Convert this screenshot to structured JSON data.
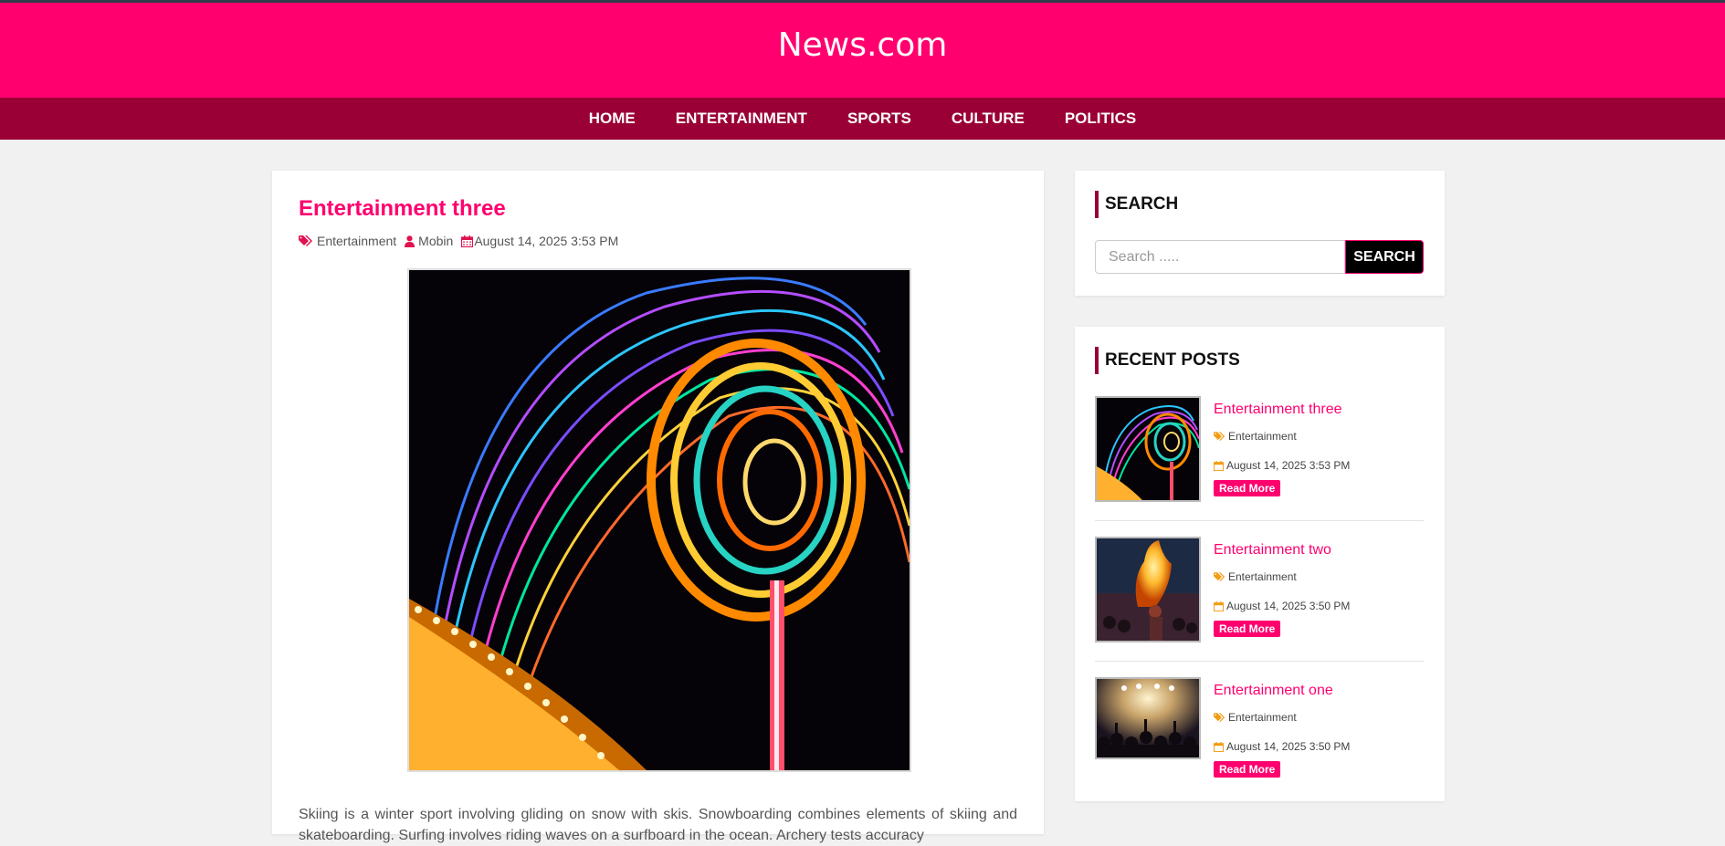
{
  "header": {
    "site_title": "News.com"
  },
  "nav": {
    "items": [
      "HOME",
      "ENTERTAINMENT",
      "SPORTS",
      "CULTURE",
      "POLITICS"
    ]
  },
  "post": {
    "title": "Entertainment three",
    "category": "Entertainment",
    "author": "Mobin",
    "date": "August 14, 2025 3:53 PM",
    "body": "Skiing is a winter sport involving gliding on snow with skis. Snowboarding combines elements of skiing and skateboarding. Surfing involves riding waves on a surfboard in the ocean. Archery tests accuracy"
  },
  "sidebar": {
    "search": {
      "title": "SEARCH",
      "placeholder": "Search .....",
      "button_label": "SEARCH"
    },
    "recent": {
      "title": "RECENT POSTS",
      "items": [
        {
          "title": "Entertainment three",
          "category": "Entertainment",
          "date": "August 14, 2025 3:53 PM",
          "button": "Read More"
        },
        {
          "title": "Entertainment two",
          "category": "Entertainment",
          "date": "August 14, 2025 3:50 PM",
          "button": "Read More"
        },
        {
          "title": "Entertainment one",
          "category": "Entertainment",
          "date": "August 14, 2025 3:50 PM",
          "button": "Read More"
        }
      ]
    }
  },
  "colors": {
    "brand": "#ff006e",
    "nav": "#9a0035",
    "meta_icon": "#e0114f",
    "recent_icon": "#f39c12"
  }
}
